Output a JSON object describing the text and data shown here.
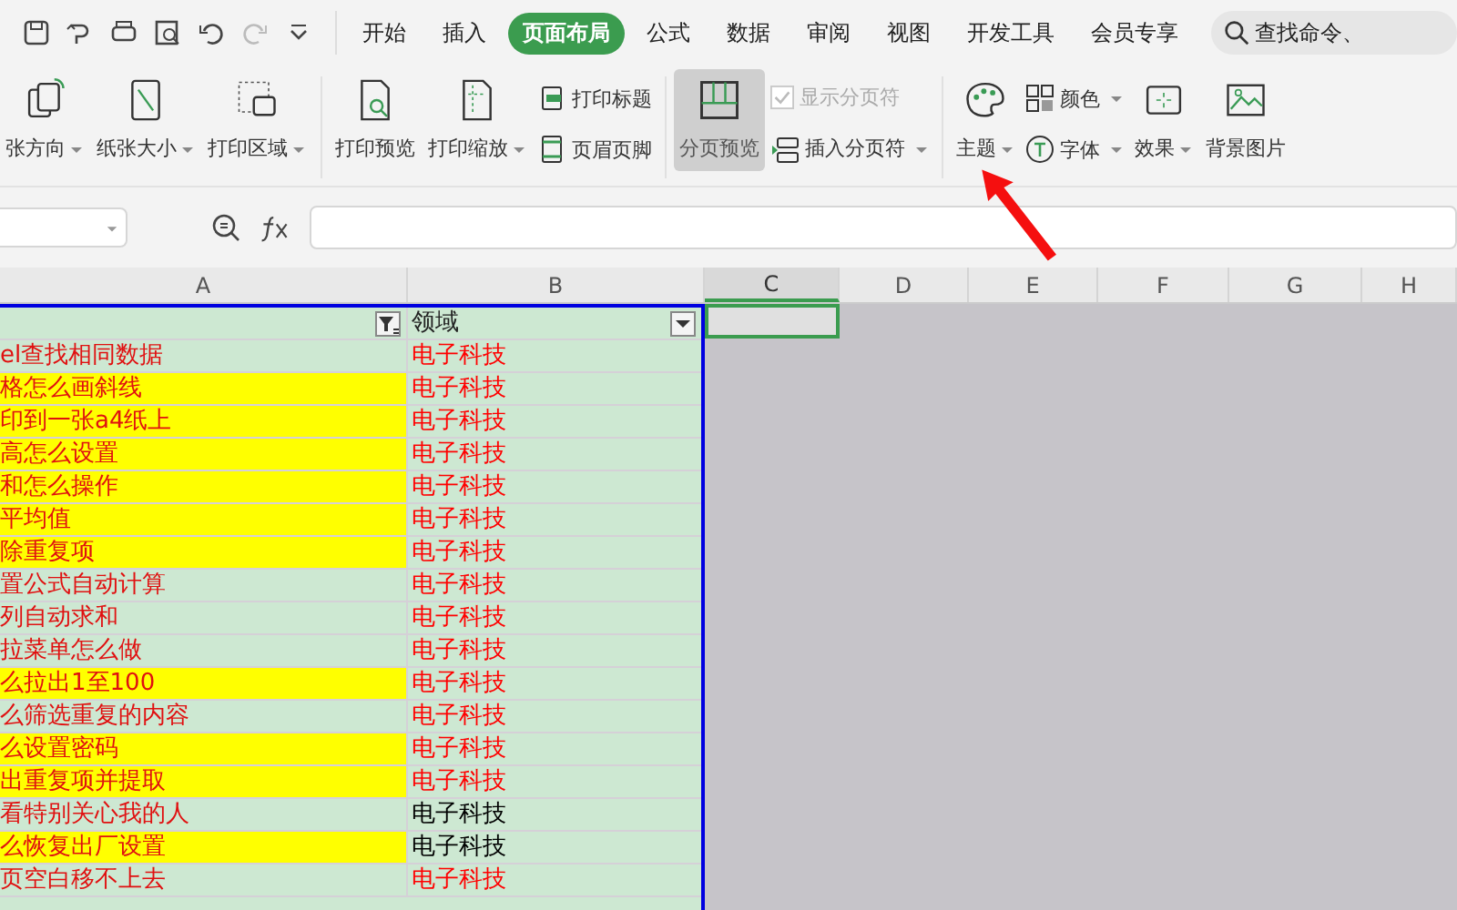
{
  "menu_tabs": [
    {
      "label": "开始",
      "selected": false
    },
    {
      "label": "插入",
      "selected": false
    },
    {
      "label": "页面布局",
      "selected": true
    },
    {
      "label": "公式",
      "selected": false
    },
    {
      "label": "数据",
      "selected": false
    },
    {
      "label": "审阅",
      "selected": false
    },
    {
      "label": "视图",
      "selected": false
    },
    {
      "label": "开发工具",
      "selected": false
    },
    {
      "label": "会员专享",
      "selected": false
    }
  ],
  "search": {
    "placeholder": "查找命令、"
  },
  "ribbon": [
    {
      "kind": "large",
      "label": "张方向",
      "dropdown": true,
      "pressed": false
    },
    {
      "kind": "large",
      "label": "纸张大小",
      "dropdown": true,
      "pressed": false
    },
    {
      "kind": "large",
      "label": "打印区域",
      "dropdown": true,
      "pressed": false
    },
    {
      "kind": "separator"
    },
    {
      "kind": "large",
      "label": "打印预览",
      "dropdown": false,
      "pressed": false
    },
    {
      "kind": "large",
      "label": "打印缩放",
      "dropdown": true,
      "pressed": false
    },
    {
      "kind": "stack",
      "items": [
        {
          "kind": "button",
          "label": "打印标题",
          "dropdown": false
        },
        {
          "kind": "button",
          "label": "页眉页脚",
          "dropdown": false
        }
      ]
    },
    {
      "kind": "separator"
    },
    {
      "kind": "large",
      "label": "分页预览",
      "dropdown": false,
      "pressed": true
    },
    {
      "kind": "stack",
      "items": [
        {
          "kind": "checkbox",
          "label": "显示分页符",
          "checked": true,
          "disabled": true
        },
        {
          "kind": "button",
          "label": "插入分页符",
          "dropdown": true
        }
      ]
    },
    {
      "kind": "separator"
    },
    {
      "kind": "large",
      "label": "主题",
      "dropdown": true,
      "pressed": false
    },
    {
      "kind": "stack",
      "items": [
        {
          "kind": "button",
          "label": "颜色",
          "dropdown": true
        },
        {
          "kind": "button",
          "label": "字体",
          "dropdown": true
        }
      ]
    },
    {
      "kind": "large",
      "label": "效果",
      "dropdown": true,
      "pressed": false
    },
    {
      "kind": "large",
      "label": "背景图片",
      "dropdown": false,
      "pressed": false
    }
  ],
  "columns": [
    {
      "label": "A",
      "selected": false
    },
    {
      "label": "B",
      "selected": false
    },
    {
      "label": "C",
      "selected": true
    },
    {
      "label": "D",
      "selected": false
    },
    {
      "label": "E",
      "selected": false
    },
    {
      "label": "F",
      "selected": false
    },
    {
      "label": "G",
      "selected": false
    },
    {
      "label": "H",
      "selected": false
    }
  ],
  "header_row": {
    "column_b": "领域"
  },
  "rows": [
    {
      "a": "el查找相同数据",
      "highlighted": false,
      "b": "电子科技",
      "color": "#ff0000"
    },
    {
      "a": "格怎么画斜线",
      "highlighted": true,
      "b": "电子科技",
      "color": "#ff0000"
    },
    {
      "a": "印到一张a4纸上",
      "highlighted": true,
      "b": "电子科技",
      "color": "#ff0000"
    },
    {
      "a": "高怎么设置",
      "highlighted": true,
      "b": "电子科技",
      "color": "#ff0000"
    },
    {
      "a": "和怎么操作",
      "highlighted": true,
      "b": "电子科技",
      "color": "#ff0000"
    },
    {
      "a": "平均值",
      "highlighted": true,
      "b": "电子科技",
      "color": "#ff0000"
    },
    {
      "a": "除重复项",
      "highlighted": true,
      "b": "电子科技",
      "color": "#ff0000"
    },
    {
      "a": "置公式自动计算",
      "highlighted": false,
      "b": "电子科技",
      "color": "#ff0000"
    },
    {
      "a": "列自动求和",
      "highlighted": false,
      "b": "电子科技",
      "color": "#ff0000"
    },
    {
      "a": "拉菜单怎么做",
      "highlighted": false,
      "b": "电子科技",
      "color": "#ff0000"
    },
    {
      "a": "么拉出1至100",
      "highlighted": true,
      "b": "电子科技",
      "color": "#ff0000"
    },
    {
      "a": "么筛选重复的内容",
      "highlighted": false,
      "b": "电子科技",
      "color": "#ff0000"
    },
    {
      "a": "么设置密码",
      "highlighted": true,
      "b": "电子科技",
      "color": "#ff0000"
    },
    {
      "a": "出重复项并提取",
      "highlighted": true,
      "b": "电子科技",
      "color": "#ff0000"
    },
    {
      "a": "看特别关心我的人",
      "highlighted": false,
      "b": "电子科技",
      "color": "#000000"
    },
    {
      "a": "么恢复出厂设置",
      "highlighted": true,
      "b": "电子科技",
      "color": "#000000"
    },
    {
      "a": "页空白移不上去",
      "highlighted": false,
      "b": "电子科技",
      "color": "#ff0000"
    }
  ]
}
